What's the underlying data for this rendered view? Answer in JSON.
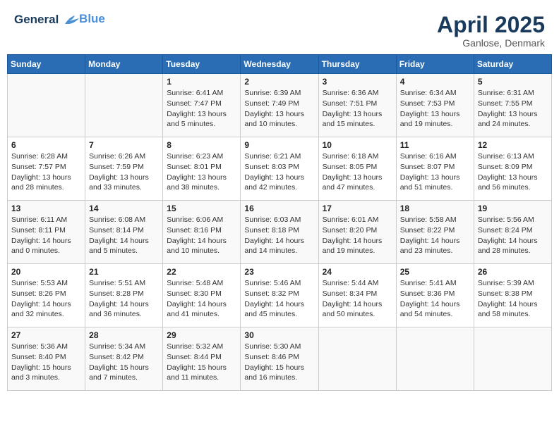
{
  "header": {
    "logo_line1": "General",
    "logo_line2": "Blue",
    "month_year": "April 2025",
    "location": "Ganlose, Denmark"
  },
  "weekdays": [
    "Sunday",
    "Monday",
    "Tuesday",
    "Wednesday",
    "Thursday",
    "Friday",
    "Saturday"
  ],
  "weeks": [
    [
      {
        "day": "",
        "info": ""
      },
      {
        "day": "",
        "info": ""
      },
      {
        "day": "1",
        "info": "Sunrise: 6:41 AM\nSunset: 7:47 PM\nDaylight: 13 hours and 5 minutes."
      },
      {
        "day": "2",
        "info": "Sunrise: 6:39 AM\nSunset: 7:49 PM\nDaylight: 13 hours and 10 minutes."
      },
      {
        "day": "3",
        "info": "Sunrise: 6:36 AM\nSunset: 7:51 PM\nDaylight: 13 hours and 15 minutes."
      },
      {
        "day": "4",
        "info": "Sunrise: 6:34 AM\nSunset: 7:53 PM\nDaylight: 13 hours and 19 minutes."
      },
      {
        "day": "5",
        "info": "Sunrise: 6:31 AM\nSunset: 7:55 PM\nDaylight: 13 hours and 24 minutes."
      }
    ],
    [
      {
        "day": "6",
        "info": "Sunrise: 6:28 AM\nSunset: 7:57 PM\nDaylight: 13 hours and 28 minutes."
      },
      {
        "day": "7",
        "info": "Sunrise: 6:26 AM\nSunset: 7:59 PM\nDaylight: 13 hours and 33 minutes."
      },
      {
        "day": "8",
        "info": "Sunrise: 6:23 AM\nSunset: 8:01 PM\nDaylight: 13 hours and 38 minutes."
      },
      {
        "day": "9",
        "info": "Sunrise: 6:21 AM\nSunset: 8:03 PM\nDaylight: 13 hours and 42 minutes."
      },
      {
        "day": "10",
        "info": "Sunrise: 6:18 AM\nSunset: 8:05 PM\nDaylight: 13 hours and 47 minutes."
      },
      {
        "day": "11",
        "info": "Sunrise: 6:16 AM\nSunset: 8:07 PM\nDaylight: 13 hours and 51 minutes."
      },
      {
        "day": "12",
        "info": "Sunrise: 6:13 AM\nSunset: 8:09 PM\nDaylight: 13 hours and 56 minutes."
      }
    ],
    [
      {
        "day": "13",
        "info": "Sunrise: 6:11 AM\nSunset: 8:11 PM\nDaylight: 14 hours and 0 minutes."
      },
      {
        "day": "14",
        "info": "Sunrise: 6:08 AM\nSunset: 8:14 PM\nDaylight: 14 hours and 5 minutes."
      },
      {
        "day": "15",
        "info": "Sunrise: 6:06 AM\nSunset: 8:16 PM\nDaylight: 14 hours and 10 minutes."
      },
      {
        "day": "16",
        "info": "Sunrise: 6:03 AM\nSunset: 8:18 PM\nDaylight: 14 hours and 14 minutes."
      },
      {
        "day": "17",
        "info": "Sunrise: 6:01 AM\nSunset: 8:20 PM\nDaylight: 14 hours and 19 minutes."
      },
      {
        "day": "18",
        "info": "Sunrise: 5:58 AM\nSunset: 8:22 PM\nDaylight: 14 hours and 23 minutes."
      },
      {
        "day": "19",
        "info": "Sunrise: 5:56 AM\nSunset: 8:24 PM\nDaylight: 14 hours and 28 minutes."
      }
    ],
    [
      {
        "day": "20",
        "info": "Sunrise: 5:53 AM\nSunset: 8:26 PM\nDaylight: 14 hours and 32 minutes."
      },
      {
        "day": "21",
        "info": "Sunrise: 5:51 AM\nSunset: 8:28 PM\nDaylight: 14 hours and 36 minutes."
      },
      {
        "day": "22",
        "info": "Sunrise: 5:48 AM\nSunset: 8:30 PM\nDaylight: 14 hours and 41 minutes."
      },
      {
        "day": "23",
        "info": "Sunrise: 5:46 AM\nSunset: 8:32 PM\nDaylight: 14 hours and 45 minutes."
      },
      {
        "day": "24",
        "info": "Sunrise: 5:44 AM\nSunset: 8:34 PM\nDaylight: 14 hours and 50 minutes."
      },
      {
        "day": "25",
        "info": "Sunrise: 5:41 AM\nSunset: 8:36 PM\nDaylight: 14 hours and 54 minutes."
      },
      {
        "day": "26",
        "info": "Sunrise: 5:39 AM\nSunset: 8:38 PM\nDaylight: 14 hours and 58 minutes."
      }
    ],
    [
      {
        "day": "27",
        "info": "Sunrise: 5:36 AM\nSunset: 8:40 PM\nDaylight: 15 hours and 3 minutes."
      },
      {
        "day": "28",
        "info": "Sunrise: 5:34 AM\nSunset: 8:42 PM\nDaylight: 15 hours and 7 minutes."
      },
      {
        "day": "29",
        "info": "Sunrise: 5:32 AM\nSunset: 8:44 PM\nDaylight: 15 hours and 11 minutes."
      },
      {
        "day": "30",
        "info": "Sunrise: 5:30 AM\nSunset: 8:46 PM\nDaylight: 15 hours and 16 minutes."
      },
      {
        "day": "",
        "info": ""
      },
      {
        "day": "",
        "info": ""
      },
      {
        "day": "",
        "info": ""
      }
    ]
  ]
}
